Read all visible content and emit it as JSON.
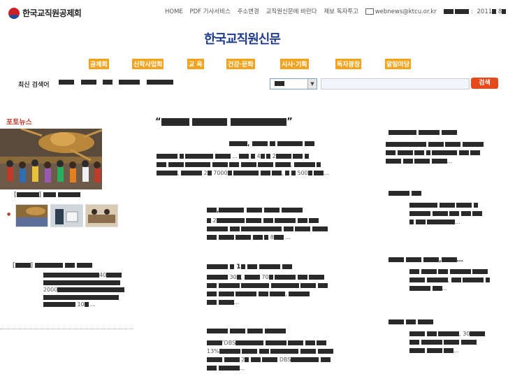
{
  "header": {
    "logo_text": "한국교직원공제회",
    "nav": [
      {
        "label": "HOME"
      },
      {
        "label": "PDF 기사서비스"
      },
      {
        "label": "주소변경"
      },
      {
        "label": "교직원신문에 바란다"
      },
      {
        "label": "제보 독자투고"
      },
      {
        "label": "webnews@ktcu.or.kr"
      }
    ],
    "date_year": "2011",
    "date_m": "8",
    "date_d": "8"
  },
  "masthead": "한국교직원신문",
  "categories": [
    "공제회",
    "신학사업회",
    "교 육",
    "건강·문화",
    "시사·기획",
    "독자광장",
    "알림마당"
  ],
  "search": {
    "label": "최신 검색어",
    "button": "검색"
  },
  "photo_news": {
    "title": "포토뉴스"
  },
  "left_note": {
    "num1": "40",
    "num2": "2000",
    "num3": "10"
  },
  "center": {
    "lead_nums": [
      "4",
      "2",
      "2",
      "7000",
      "500"
    ],
    "story2_num": "2",
    "story2_num2": "8",
    "story3_num": "1",
    "story3_num2": "30",
    "story3_num3": "70",
    "story4_tag": "DBS",
    "story4_pct": "13%",
    "story4_num": "2",
    "story4_tag2": "DBS"
  },
  "right": {
    "num": "30"
  }
}
